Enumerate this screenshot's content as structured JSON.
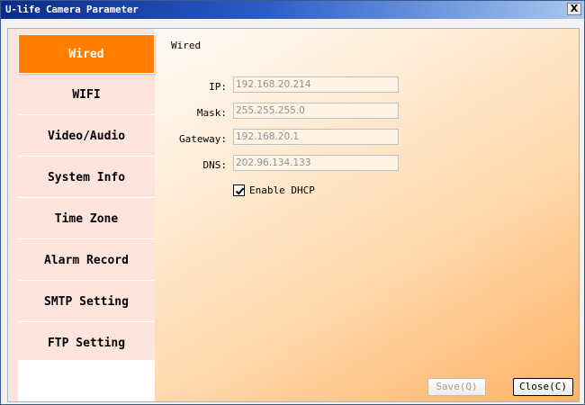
{
  "window": {
    "title": "U-life Camera Parameter",
    "close_glyph": "X",
    "close_icon": "close-icon"
  },
  "sidebar": {
    "items": [
      {
        "label": "Wired"
      },
      {
        "label": "WIFI"
      },
      {
        "label": "Video/Audio"
      },
      {
        "label": "System Info"
      },
      {
        "label": "Time Zone"
      },
      {
        "label": "Alarm Record"
      },
      {
        "label": "SMTP Setting"
      },
      {
        "label": "FTP Setting"
      }
    ],
    "active_index": 0
  },
  "wired": {
    "section_title": "Wired",
    "fields": [
      {
        "label": "IP:",
        "value": "192.168.20.214"
      },
      {
        "label": "Mask:",
        "value": "255.255.255.0"
      },
      {
        "label": "Gateway:",
        "value": "192.168.20.1"
      },
      {
        "label": "DNS:",
        "value": "202.96.134.133"
      }
    ],
    "dhcp": {
      "label": "Enable DHCP",
      "checked": true,
      "check_icon": "checkmark-icon"
    }
  },
  "buttons": {
    "save": {
      "label": "Save(Q)",
      "enabled": false
    },
    "close": {
      "label": "Close(C)",
      "enabled": true
    }
  },
  "colors": {
    "active_tab": "#ff7e00",
    "sidebar_bg": "#fde4dc",
    "titlebar": "#0a2a8a",
    "field_text": "#909090"
  }
}
